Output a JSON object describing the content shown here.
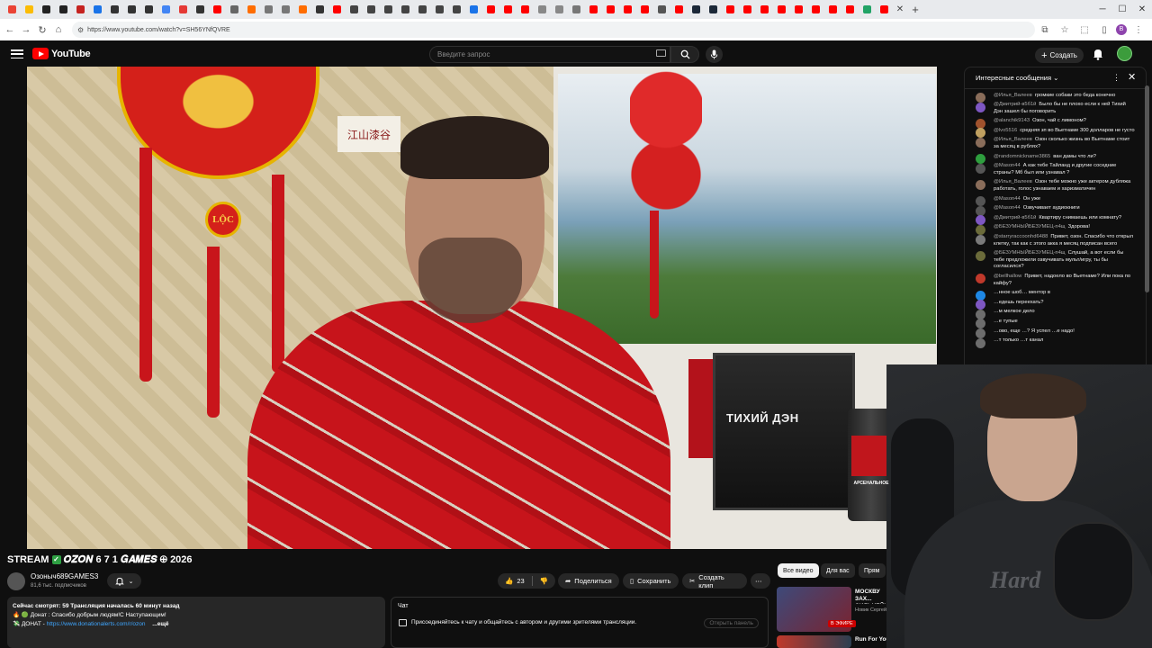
{
  "browser": {
    "tab_colors": [
      "#ea4335",
      "#fbbc05",
      "#222222",
      "#222222",
      "#c5221f",
      "#1a73e8",
      "#333333",
      "#333333",
      "#333333",
      "#4285f4",
      "#e53935",
      "#333333",
      "#ff0000",
      "#666666",
      "#ff6d00",
      "#777777",
      "#777777",
      "#ff6d00",
      "#333333",
      "#ff0000",
      "#444444",
      "#444444",
      "#444444",
      "#444444",
      "#444444",
      "#444444",
      "#444444",
      "#1a73e8",
      "#ff0000",
      "#ff0000",
      "#ff0000",
      "#888888",
      "#888888",
      "#777777",
      "#ff0000",
      "#ff0000",
      "#ff0000",
      "#ff0000",
      "#555555",
      "#ff0000",
      "#1b2838",
      "#1b2838",
      "#ff0000",
      "#ff0000",
      "#ff0000",
      "#ff0000",
      "#ff0000",
      "#ff0000",
      "#ff0000",
      "#ff0000",
      "#21a366",
      "#ff0000"
    ],
    "url": "https://www.youtube.com/watch?v=SH56YNfQVRE",
    "profile_initial": "B"
  },
  "header": {
    "logo": "YouTube",
    "search_placeholder": "Введите запрос",
    "create_label": "Создать"
  },
  "video": {
    "title_prefix": "STREAM",
    "title_main": "𝑶𝒁𝑶𝑵 6 7 1 𝑮𝑨𝑴𝑬𝑺",
    "title_suffix": "2026",
    "channel_name": "Озоныч689GAMES3",
    "channel_subs": "81,6 тыс. подписчиков",
    "likes": "23",
    "share_label": "Поделиться",
    "save_label": "Сохранить",
    "clip_label": "Создать клип",
    "more_label": "⋯"
  },
  "description": {
    "stats": "Сейчас смотрят: 59  Трансляция началась 60 минут назад",
    "line2": "🔥 🟢 Донат : Спасибо добрым людям!С Наступающим!",
    "line3_prefix": "💸 ДОНАТ - ",
    "line3_link": "https://www.donationalerts.com/r/ozon",
    "line3_more": "...ещё"
  },
  "inline_chat": {
    "title": "Чат",
    "message": "Присоединяйтесь к чату и общайтесь с автором и другими зрителями трансляции.",
    "open_label": "Открыть панель"
  },
  "chips": [
    "Все видео",
    "Для вас",
    "Прям"
  ],
  "recommended": [
    {
      "title": "МОСКВУ ЗАХ... СИЛЬНЕЙШИ...",
      "sub": "Новик Сергей · 201...",
      "badge": "В ЭФИРЕ"
    },
    {
      "title": "Run For You",
      "sub": ""
    }
  ],
  "live_chat": {
    "title": "Интересные сообщения",
    "messages": [
      {
        "author": "@Илья_Валеев",
        "text": "громкие собаки это беда конечно",
        "color": "#8a6d5a"
      },
      {
        "author": "@Дмитрий-в5б1й",
        "text": "Было бы не плохо если к ней Тихий Дэн зашел бы поговорить",
        "color": "#7e57c2"
      },
      {
        "author": "@alanchik9143",
        "text": "Озон, чай с лимоном?",
        "color": "#a0522d"
      },
      {
        "author": "@lvo5516",
        "text": "средняя зп во Вьетнаме 300 долларов не густо",
        "color": "#c0a060"
      },
      {
        "author": "@Илья_Валеев",
        "text": "Озон сколько жизнь во Вьетнаме стоит за месяц в рублях?",
        "color": "#8a6d5a"
      },
      {
        "author": "@randomnickname3865",
        "text": "ван дамы что ли?",
        "color": "#2e9e3e"
      },
      {
        "author": "@Mason44",
        "text": "А как тебе Тайланд и другие соседние страны? Мб был или узнавал ?",
        "color": "#555555"
      },
      {
        "author": "@Илья_Валеев",
        "text": "Озон тебе можно уже актером дубляжа работать, голос узнаваем и харизматичен",
        "color": "#8a6d5a"
      },
      {
        "author": "@Mason44",
        "text": "Он уже",
        "color": "#555555"
      },
      {
        "author": "@Mason44",
        "text": "Озвучивает аудиокниги",
        "color": "#555555"
      },
      {
        "author": "@Дмитрий-в5б1й",
        "text": "Квартиру снимаешь или комнату?",
        "color": "#7e57c2"
      },
      {
        "author": "@БЕЗУМНЫЙБЕЗУМЕЦ-п4щ",
        "text": "Здорова!",
        "color": "#6b6b3a"
      },
      {
        "author": "@starryraccoonhd6488",
        "text": "Привет, озон. Спасибо что открыл клетку, так как с этого акка я месяц подписан всего",
        "color": "#7a7a7a"
      },
      {
        "author": "@БЕЗУМНЫЙБЕЗУМЕЦ-п4щ",
        "text": "Слушай, а вот если бы тебе предложили озвучивать мульт/игру, ты бы согласился?",
        "color": "#6b6b3a"
      },
      {
        "author": "@bellhallow",
        "text": "Привет, надоело во Вьетнаме? Или пока по кайфу?",
        "color": "#c0392b"
      },
      {
        "author": "",
        "text": "…нное шоб… ментор в",
        "color": "#1e88e5"
      },
      {
        "author": "",
        "text": "…едешь переехать?",
        "color": "#7e57c2"
      },
      {
        "author": "",
        "text": "…м мелкое дело",
        "color": "#6d6d6d"
      },
      {
        "author": "",
        "text": "…е тупые",
        "color": "#6d6d6d"
      },
      {
        "author": "",
        "text": "…ово, еще …? Я успел …е надо!",
        "color": "#6d6d6d"
      },
      {
        "author": "",
        "text": "…т только …т канал",
        "color": "#6d6d6d"
      }
    ]
  },
  "video_scene": {
    "poster_title": "ТИХИЙ ДЭН",
    "can_label": "АРСЕНАЛЬНОЕ",
    "medallion_text": "LỘC",
    "scroll_text": "江山漆谷",
    "webcam_logo": "Hard"
  }
}
